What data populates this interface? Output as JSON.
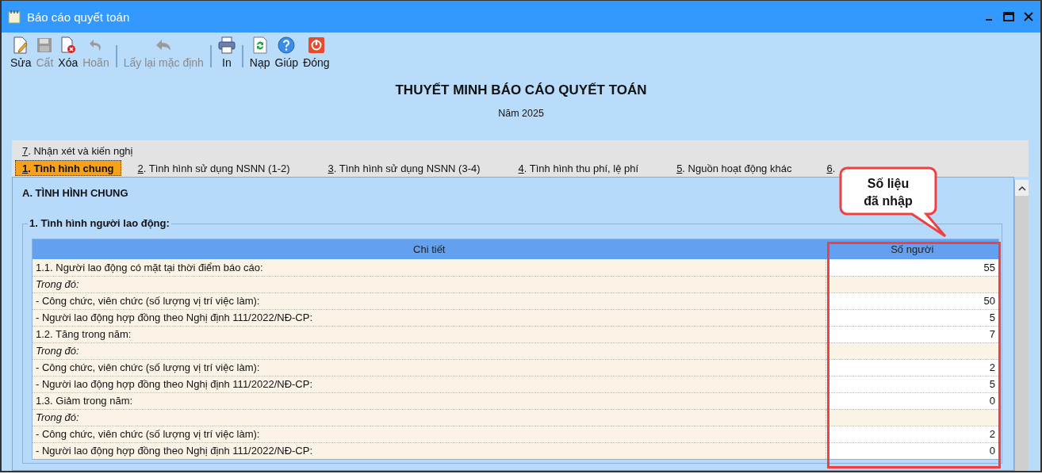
{
  "window": {
    "title": "Báo cáo quyết toán"
  },
  "toolbar": [
    {
      "kind": "button",
      "label": "Sửa",
      "disabled": false
    },
    {
      "kind": "button",
      "label": "Cất",
      "disabled": true
    },
    {
      "kind": "button",
      "label": "Xóa",
      "disabled": false
    },
    {
      "kind": "button",
      "label": "Hoãn",
      "disabled": true
    },
    {
      "kind": "separator"
    },
    {
      "kind": "button",
      "label": "Lấy lại mặc định",
      "disabled": true
    },
    {
      "kind": "separator"
    },
    {
      "kind": "button",
      "label": "In",
      "disabled": false
    },
    {
      "kind": "separator"
    },
    {
      "kind": "button",
      "label": "Nạp",
      "disabled": false
    },
    {
      "kind": "button",
      "label": "Giúp",
      "disabled": false
    },
    {
      "kind": "button",
      "label": "Đóng",
      "disabled": false
    }
  ],
  "report": {
    "title": "THUYẾT MINH BÁO CÁO QUYẾT TOÁN",
    "year": "Năm 2025"
  },
  "tab_rows": [
    [
      {
        "label": "7. Nhận xét và kiến nghị",
        "selected": false
      }
    ],
    [
      {
        "label": "1. Tình hình chung",
        "selected": true
      },
      {
        "label": "2. Tình hình sử dụng NSNN (1-2)",
        "selected": false
      },
      {
        "label": "3. Tình hình sử dụng NSNN (3-4)",
        "selected": false
      },
      {
        "label": "4. Tình hình thu phí, lệ phí",
        "selected": false
      },
      {
        "label": "5. Nguồn hoạt động khác",
        "selected": false
      },
      {
        "label": "6.",
        "selected": false
      }
    ]
  ],
  "section_title": "A. TÌNH HÌNH CHUNG",
  "group": {
    "legend": "1. Tình hình người lao động:",
    "table": {
      "columns": [
        "Chi tiết",
        "Số người"
      ],
      "rows": [
        {
          "kind": "item",
          "label": "1.1. Người lao động có mặt tại thời điểm báo cáo:",
          "value": "55"
        },
        {
          "kind": "note",
          "label": "Trong đó:"
        },
        {
          "kind": "item",
          "label": "- Công chức, viên chức (số lượng vị trí việc làm):",
          "value": "50"
        },
        {
          "kind": "item",
          "label": "- Người lao động hợp đồng theo Nghị định 111/2022/NĐ-CP:",
          "value": "5"
        },
        {
          "kind": "item",
          "label": "1.2. Tăng trong năm:",
          "value": "7"
        },
        {
          "kind": "note",
          "label": "Trong đó:"
        },
        {
          "kind": "item",
          "label": "- Công chức, viên chức (số lượng vị trí việc làm):",
          "value": "2"
        },
        {
          "kind": "item",
          "label": "- Người lao động hợp đồng theo Nghị định 111/2022/NĐ-CP:",
          "value": "5"
        },
        {
          "kind": "item",
          "label": "1.3. Giảm trong năm:",
          "value": "0"
        },
        {
          "kind": "note",
          "label": "Trong đó:"
        },
        {
          "kind": "item",
          "label": "- Công chức, viên chức (số lượng vị trí việc làm):",
          "value": "2"
        },
        {
          "kind": "item",
          "label": "- Người lao động hợp đồng theo Nghị định 111/2022/NĐ-CP:",
          "value": "0"
        }
      ]
    }
  },
  "callout": {
    "text": "Số liệu đã nhập"
  }
}
